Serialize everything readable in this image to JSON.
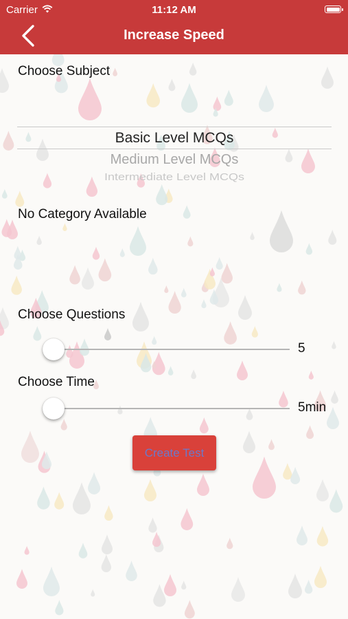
{
  "status_bar": {
    "carrier": "Carrier",
    "time": "11:12 AM"
  },
  "nav": {
    "title": "Increase Speed",
    "back_icon": "chevron-left-icon"
  },
  "subject": {
    "label": "Choose Subject",
    "options": [
      "Basic Level MCQs",
      "Medium Level MCQs",
      "Intermediate Level MCQs"
    ],
    "selected": "Basic Level MCQs"
  },
  "category": {
    "label": "No Category Available"
  },
  "questions": {
    "label": "Choose Questions",
    "value": "5",
    "level": 0
  },
  "time": {
    "label": "Choose Time",
    "value": "5min",
    "level": 0
  },
  "create_button": {
    "label": "Create Test"
  },
  "colors": {
    "nav": "#c73a3a",
    "button": "#d9413a",
    "button_text": "#6c79c9"
  }
}
